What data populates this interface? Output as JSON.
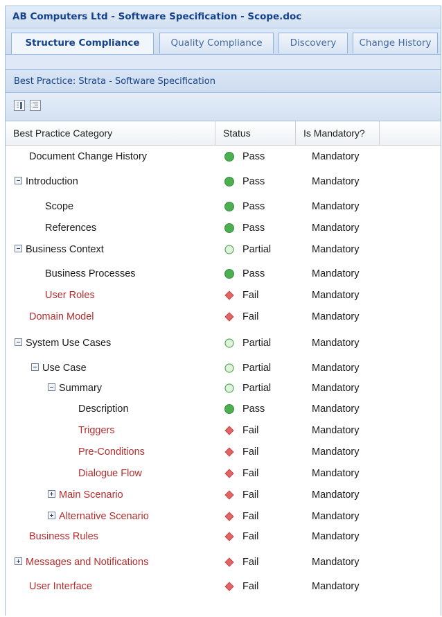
{
  "window": {
    "title": "AB Computers Ltd - Software Specification - Scope.doc"
  },
  "tabs": [
    "Structure Compliance",
    "Quality Compliance",
    "Discovery",
    "Change History"
  ],
  "best_practice": "Best Practice: Strata - Software Specification",
  "toolbar": {
    "icons": [
      "expand-all-icon",
      "collapse-all-icon"
    ]
  },
  "columns": [
    "Best Practice Category",
    "Status",
    "Is Mandatory?"
  ],
  "status_colors": {
    "pass": "#4caf50",
    "partial": "#dff2dc",
    "fail": "#e06666",
    "fail_text": "#b22d2d"
  },
  "rows": [
    {
      "name": "Document Change History",
      "status": "Pass",
      "mandatory": "Mandatory"
    },
    {
      "name": "Introduction",
      "status": "Pass",
      "mandatory": "Mandatory"
    },
    {
      "name": "Scope",
      "status": "Pass",
      "mandatory": "Mandatory"
    },
    {
      "name": "References",
      "status": "Pass",
      "mandatory": "Mandatory"
    },
    {
      "name": "Business Context",
      "status": "Partial",
      "mandatory": "Mandatory"
    },
    {
      "name": "Business Processes",
      "status": "Pass",
      "mandatory": "Mandatory"
    },
    {
      "name": "User Roles",
      "status": "Fail",
      "mandatory": "Mandatory"
    },
    {
      "name": "Domain Model",
      "status": "Fail",
      "mandatory": "Mandatory"
    },
    {
      "name": "System Use Cases",
      "status": "Partial",
      "mandatory": "Mandatory"
    },
    {
      "name": "Use Case",
      "status": "Partial",
      "mandatory": "Mandatory"
    },
    {
      "name": "Summary",
      "status": "Partial",
      "mandatory": "Mandatory"
    },
    {
      "name": "Description",
      "status": "Pass",
      "mandatory": "Mandatory"
    },
    {
      "name": "Triggers",
      "status": "Fail",
      "mandatory": "Mandatory"
    },
    {
      "name": "Pre-Conditions",
      "status": "Fail",
      "mandatory": "Mandatory"
    },
    {
      "name": "Dialogue Flow",
      "status": "Fail",
      "mandatory": "Mandatory"
    },
    {
      "name": "Main Scenario",
      "status": "Fail",
      "mandatory": "Mandatory"
    },
    {
      "name": "Alternative Scenario",
      "status": "Fail",
      "mandatory": "Mandatory"
    },
    {
      "name": "Business Rules",
      "status": "Fail",
      "mandatory": "Mandatory"
    },
    {
      "name": "Messages and Notifications",
      "status": "Fail",
      "mandatory": "Mandatory"
    },
    {
      "name": "User Interface",
      "status": "Fail",
      "mandatory": "Mandatory"
    }
  ]
}
